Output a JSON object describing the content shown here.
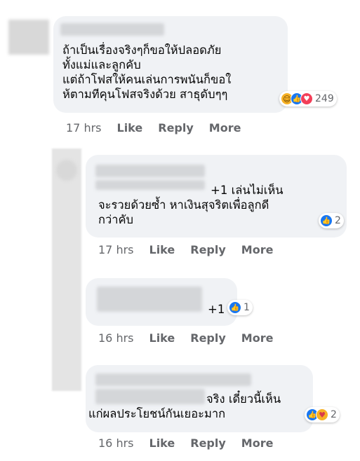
{
  "comments": [
    {
      "text": "ถ้าเป็นเรื่องจริงๆก็ขอให้ปลอดภัย\nทั้งแม่และลูกคับ\nแต่ถ้าโฟสให้คนเล่นการพนันก็ขอใ\nห้ตามทีคุนโฟสจริงด้วย สาธุดับๆๆ",
      "reaction_icons": [
        "haha-icon",
        "like-icon",
        "love-icon"
      ],
      "reaction_count": "249",
      "time": "17 hrs",
      "like": "Like",
      "reply": "Reply",
      "more": "More"
    },
    {
      "text": "+1 เล่นไม่เห็น\nจะรวยด้วยซ้ำ หาเงินสุจริตเพื่อลูกดี\nกว่าคับ",
      "reaction_icons": [
        "like-icon"
      ],
      "reaction_count": "2",
      "time": "17 hrs",
      "like": "Like",
      "reply": "Reply",
      "more": "More"
    },
    {
      "text": "+1",
      "reaction_icons": [
        "like-icon"
      ],
      "reaction_count": "1",
      "time": "16 hrs",
      "like": "Like",
      "reply": "Reply",
      "more": "More"
    },
    {
      "text": "จริง เดี๋ยวนี้เห็น\nแก่ผลประโยชน์กันเยอะมาก",
      "reaction_icons": [
        "like-icon",
        "care-icon"
      ],
      "reaction_count": "2",
      "time": "16 hrs",
      "like": "Like",
      "reply": "Reply",
      "more": "More"
    }
  ]
}
